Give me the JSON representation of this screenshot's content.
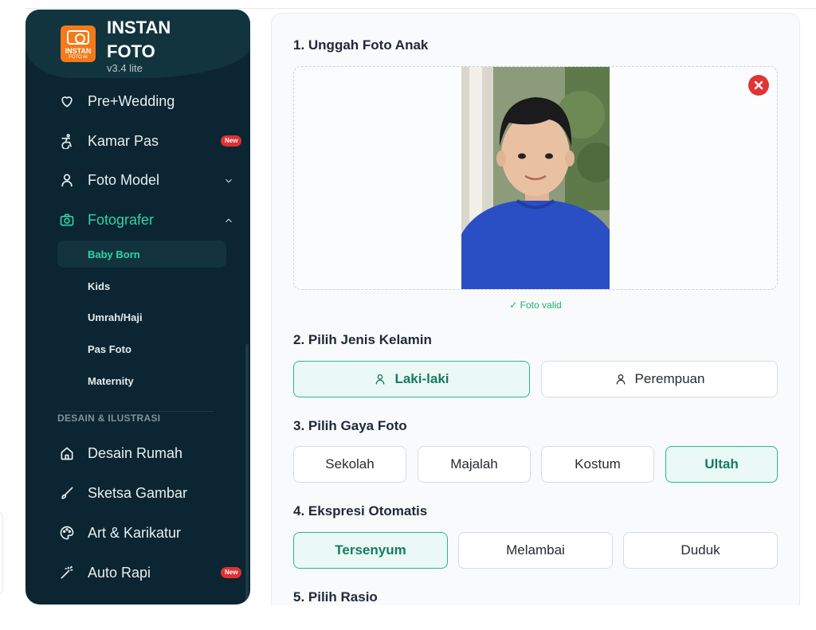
{
  "brand": {
    "name_line1": "INSTAN",
    "name_line2": "FOTO",
    "version": "v3.4 lite",
    "logo_text": "INSTAN",
    "logo_sub": "FOTO AI"
  },
  "sidebar": {
    "items": [
      {
        "label": "Pre+Wedding",
        "icon": "heart-icon"
      },
      {
        "label": "Kamar Pas",
        "icon": "accessibility-icon",
        "badge": "New"
      },
      {
        "label": "Foto Model",
        "icon": "user-icon"
      },
      {
        "label": "Fotografer",
        "icon": "camera-icon"
      }
    ],
    "sub_items": [
      "Baby Born",
      "Kids",
      "Umrah/Haji",
      "Pas Foto",
      "Maternity"
    ],
    "section_label": "DESAIN & ILUSTRASI",
    "section_items": [
      {
        "label": "Desain Rumah",
        "icon": "home-icon"
      },
      {
        "label": "Sketsa Gambar",
        "icon": "brush-icon"
      },
      {
        "label": "Art & Karikatur",
        "icon": "palette-icon"
      },
      {
        "label": "Auto Rapi",
        "icon": "magic-wand-icon",
        "badge": "New"
      }
    ]
  },
  "main": {
    "step1": "1. Unggah Foto Anak",
    "valid": "✓ Foto valid",
    "step2": "2. Pilih Jenis Kelamin",
    "gender": [
      "Laki-laki",
      "Perempuan"
    ],
    "step3": "3. Pilih Gaya Foto",
    "styles": [
      "Sekolah",
      "Majalah",
      "Kostum",
      "Ultah"
    ],
    "step4": "4. Ekspresi Otomatis",
    "expressions": [
      "Tersenyum",
      "Melambai",
      "Duduk"
    ],
    "step5": "5. Pilih Rasio"
  },
  "colors": {
    "sidebar_bg": "#0b2532",
    "accent": "#2dd4a7",
    "selected_bg": "#eaf9f5",
    "danger": "#e03535",
    "valid": "#1fae6a"
  }
}
